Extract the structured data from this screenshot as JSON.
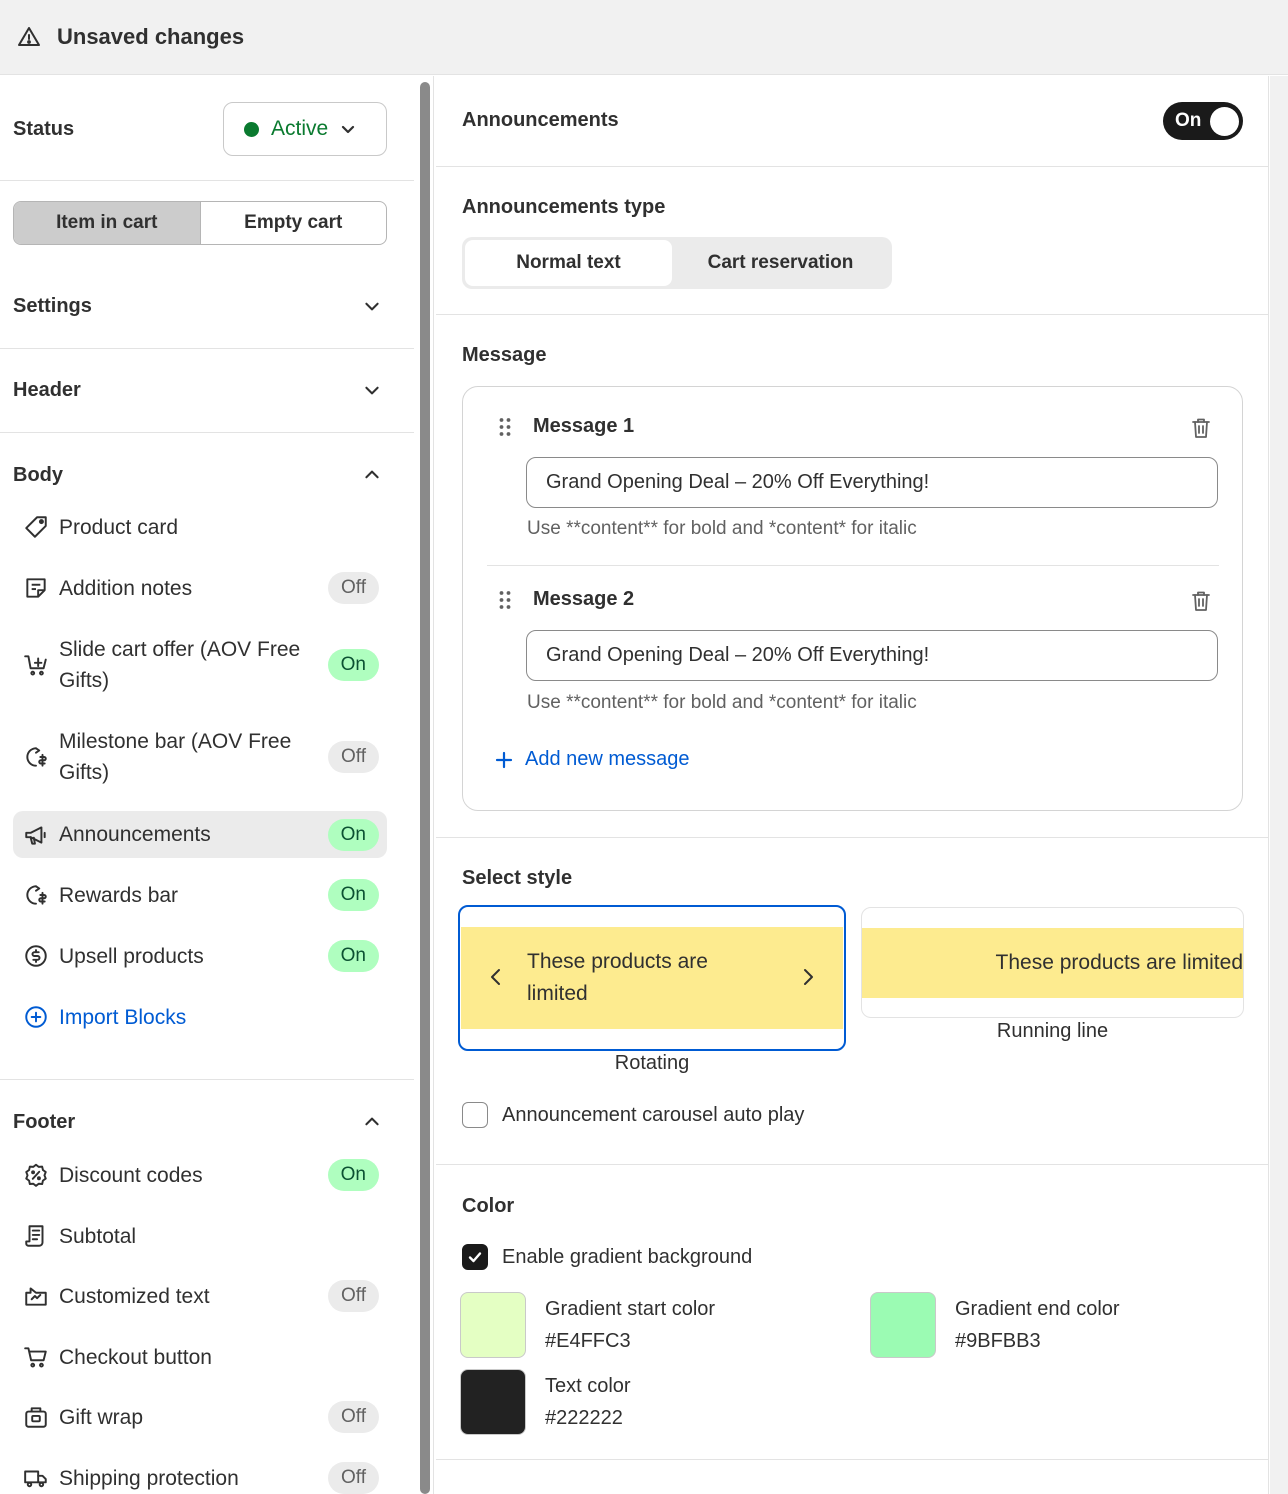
{
  "topbar": {
    "title": "Unsaved changes",
    "icon": "warning-triangle-icon"
  },
  "sidebar": {
    "status_label": "Status",
    "status_value": "Active",
    "cart_tabs": [
      "Item in cart",
      "Empty cart"
    ],
    "settings_label": "Settings",
    "header_label": "Header",
    "body_label": "Body",
    "body_items": [
      {
        "label": "Product card",
        "icon": "tag-icon",
        "badge": ""
      },
      {
        "label": "Addition notes",
        "icon": "note-icon",
        "badge": "Off"
      },
      {
        "label": "Slide cart offer (AOV Free Gifts)",
        "icon": "cart-gift-icon",
        "badge": "On"
      },
      {
        "label": "Milestone bar (AOV Free Gifts)",
        "icon": "milestone-icon",
        "badge": "Off"
      },
      {
        "label": "Announcements",
        "icon": "megaphone-icon",
        "badge": "On"
      },
      {
        "label": "Rewards bar",
        "icon": "rewards-icon",
        "badge": "On"
      },
      {
        "label": "Upsell products",
        "icon": "dollar-circle-icon",
        "badge": "On"
      }
    ],
    "import_label": "Import Blocks",
    "footer_label": "Footer",
    "footer_items": [
      {
        "label": "Discount codes",
        "icon": "discount-icon",
        "badge": "On"
      },
      {
        "label": "Subtotal",
        "icon": "receipt-icon",
        "badge": ""
      },
      {
        "label": "Customized text",
        "icon": "custom-text-icon",
        "badge": "Off"
      },
      {
        "label": "Checkout button",
        "icon": "cart-icon",
        "badge": ""
      },
      {
        "label": "Gift wrap",
        "icon": "gift-wrap-icon",
        "badge": "Off"
      },
      {
        "label": "Shipping protection",
        "icon": "truck-icon",
        "badge": "Off"
      }
    ]
  },
  "panel": {
    "announcements_label": "Announcements",
    "toggle_label": "On",
    "type_label": "Announcements type",
    "type_options": [
      "Normal text",
      "Cart reservation"
    ],
    "message_label": "Message",
    "messages": [
      {
        "title": "Message 1",
        "value": "Grand Opening Deal – 20% Off Everything!",
        "hint": "Use **content** for bold and *content* for italic"
      },
      {
        "title": "Message 2",
        "value": "Grand Opening Deal – 20% Off Everything!",
        "hint": "Use **content** for bold and *content* for italic"
      }
    ],
    "add_message_label": "Add new message",
    "style_label": "Select style",
    "styles": [
      {
        "banner_text": "These products are limited",
        "caption": "Rotating"
      },
      {
        "banner_text": "These products are limited",
        "caption": "Running line"
      }
    ],
    "autoplay_label": "Announcement carousel auto play",
    "color_label": "Color",
    "gradient_label": "Enable gradient background",
    "colors": [
      {
        "name": "Gradient start color",
        "hex": "#E4FFC3"
      },
      {
        "name": "Gradient end color",
        "hex": "#9BFBB3"
      },
      {
        "name": "Text color",
        "hex": "#222222"
      }
    ],
    "banner_color": "#FDEB8F",
    "accent_color": "#005BD3"
  }
}
